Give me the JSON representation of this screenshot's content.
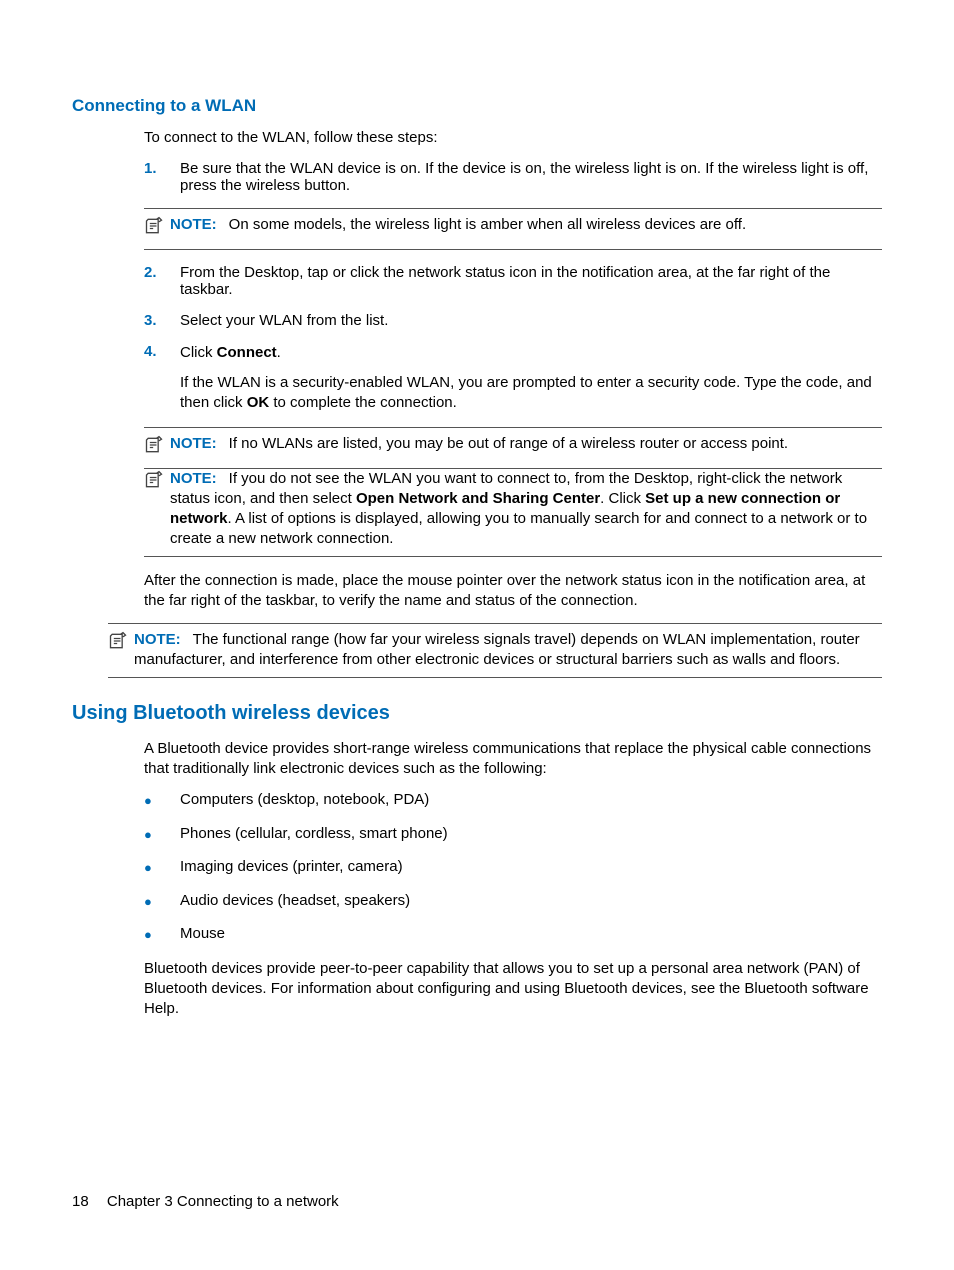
{
  "section_wlan": {
    "title": "Connecting to a WLAN",
    "intro": "To connect to the WLAN, follow these steps:",
    "steps": {
      "1": {
        "num": "1.",
        "text": "Be sure that the WLAN device is on. If the device is on, the wireless light is on. If the wireless light is off, press the wireless button."
      },
      "note1": {
        "label": "NOTE:",
        "text": "On some models, the wireless light is amber when all wireless devices are off."
      },
      "2": {
        "num": "2.",
        "text": "From the Desktop, tap or click the network status icon in the notification area, at the far right of the taskbar."
      },
      "3": {
        "num": "3.",
        "text": "Select your WLAN from the list."
      },
      "4": {
        "num": "4.",
        "line1_a": "Click ",
        "line1_b": "Connect",
        "line1_c": ".",
        "line2_a": "If the WLAN is a security-enabled WLAN, you are prompted to enter a security code. Type the code, and then click ",
        "line2_b": "OK",
        "line2_c": " to complete the connection."
      },
      "note2": {
        "label": "NOTE:",
        "text": "If no WLANs are listed, you may be out of range of a wireless router or access point."
      },
      "note3": {
        "label": "NOTE:",
        "a": "If you do not see the WLAN you want to connect to, from the Desktop, right-click the network status icon, and then select ",
        "b": "Open Network and Sharing Center",
        "c": ". Click ",
        "d": "Set up a new connection or network",
        "e": ". A list of options is displayed, allowing you to manually search for and connect to a network or to create a new network connection."
      }
    },
    "after_steps": "After the connection is made, place the mouse pointer over the network status icon in the notification area, at the far right of the taskbar, to verify the name and status of the connection.",
    "note4": {
      "label": "NOTE:",
      "text": "The functional range (how far your wireless signals travel) depends on WLAN implementation, router manufacturer, and interference from other electronic devices or structural barriers such as walls and floors."
    }
  },
  "section_bt": {
    "title": "Using Bluetooth wireless devices",
    "intro": "A Bluetooth device provides short-range wireless communications that replace the physical cable connections that traditionally link electronic devices such as the following:",
    "bullets": [
      "Computers (desktop, notebook, PDA)",
      "Phones (cellular, cordless, smart phone)",
      "Imaging devices (printer, camera)",
      "Audio devices (headset, speakers)",
      "Mouse"
    ],
    "outro": "Bluetooth devices provide peer-to-peer capability that allows you to set up a personal area network (PAN) of Bluetooth devices. For information about configuring and using Bluetooth devices, see the Bluetooth software Help."
  },
  "footer": {
    "page_number": "18",
    "chapter": "Chapter 3   Connecting to a network"
  }
}
